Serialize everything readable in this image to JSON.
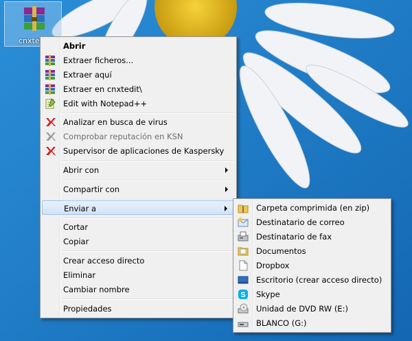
{
  "desktop": {
    "file_label": "cnxtedit",
    "colors": {
      "sky": "#1e7fc8",
      "petal": "#f4f5f7",
      "center": "#e3b820",
      "highlight": "#d2e3f7"
    }
  },
  "context_menu": {
    "items": [
      {
        "label": "Abrir",
        "icon": "open-icon",
        "bold": true
      },
      {
        "label": "Extraer ficheros...",
        "icon": "winrar-icon"
      },
      {
        "label": "Extraer aquí",
        "icon": "winrar-icon"
      },
      {
        "label": "Extraer en cnxtedit\\",
        "icon": "winrar-icon"
      },
      {
        "label": "Edit with Notepad++",
        "icon": "notepad-plus-plus-icon"
      },
      {
        "label": "Analizar en busca de virus",
        "icon": "kaspersky-icon"
      },
      {
        "label": "Comprobar reputación en KSN",
        "icon": "kaspersky-icon",
        "disabled": true
      },
      {
        "label": "Supervisor de aplicaciones de Kaspersky",
        "icon": "kaspersky-icon"
      },
      {
        "label": "Abrir con",
        "submenu": true
      },
      {
        "label": "Compartir con",
        "submenu": true
      },
      {
        "label": "Enviar a",
        "submenu": true,
        "highlighted": true
      },
      {
        "label": "Cortar"
      },
      {
        "label": "Copiar"
      },
      {
        "label": "Crear acceso directo"
      },
      {
        "label": "Eliminar"
      },
      {
        "label": "Cambiar nombre"
      },
      {
        "label": "Propiedades"
      }
    ]
  },
  "send_to_menu": {
    "items": [
      {
        "label": "Carpeta comprimida (en zip)",
        "icon": "zip-folder-icon"
      },
      {
        "label": "Destinatario de correo",
        "icon": "mail-recipient-icon"
      },
      {
        "label": "Destinatario de fax",
        "icon": "fax-icon"
      },
      {
        "label": "Documentos",
        "icon": "documents-icon"
      },
      {
        "label": "Dropbox",
        "icon": "dropbox-icon"
      },
      {
        "label": "Escritorio (crear acceso directo)",
        "icon": "desktop-icon"
      },
      {
        "label": "Skype",
        "icon": "skype-icon"
      },
      {
        "label": "Unidad de DVD RW (E:)",
        "icon": "dvd-drive-icon"
      },
      {
        "label": "BLANCO (G:)",
        "icon": "usb-drive-icon"
      }
    ]
  }
}
